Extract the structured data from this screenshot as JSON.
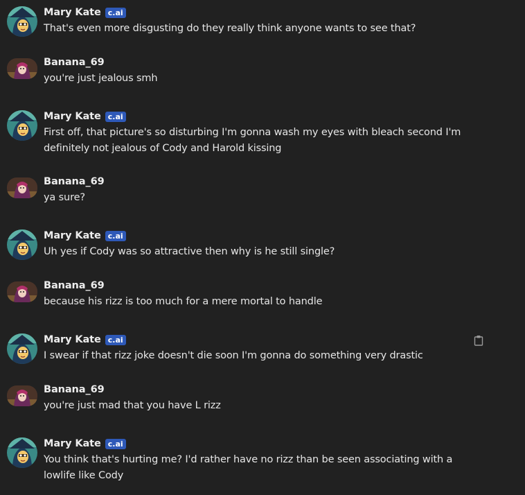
{
  "messages": [
    {
      "sender": "Mary Kate",
      "badge": "c.ai",
      "text": "That's even more disgusting do they really think anyone wants to see that?"
    },
    {
      "sender": "Banana_69",
      "text": "you're just jealous smh"
    },
    {
      "sender": "Mary Kate",
      "badge": "c.ai",
      "text": "First off, that picture's so disturbing I'm gonna wash my eyes with bleach second I'm definitely not jealous of Cody and Harold kissing"
    },
    {
      "sender": "Banana_69",
      "text": "ya sure?"
    },
    {
      "sender": "Mary Kate",
      "badge": "c.ai",
      "text": "Uh yes if Cody was so attractive then why is he still single?"
    },
    {
      "sender": "Banana_69",
      "text": "because his rizz is too much for a mere mortal to handle"
    },
    {
      "sender": "Mary Kate",
      "badge": "c.ai",
      "text": "I swear if that rizz joke doesn't die soon I'm gonna do something very drastic",
      "icon": "clipboard-icon"
    },
    {
      "sender": "Banana_69",
      "text": "you're just mad that you have L rizz"
    },
    {
      "sender": "Mary Kate",
      "badge": "c.ai",
      "text": "You think that's hurting me? I'd rather have no rizz than be seen associating with a lowlife like Cody"
    }
  ],
  "colors": {
    "background": "#212121",
    "badge": "#2e59b8",
    "text": "#e6e6e6"
  }
}
